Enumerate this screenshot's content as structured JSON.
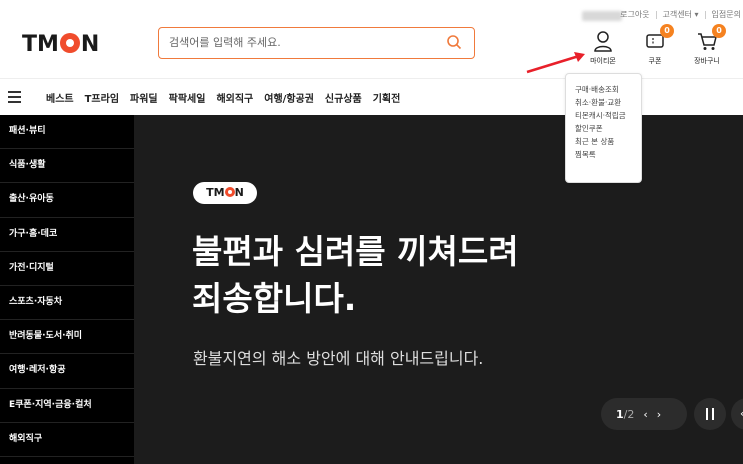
{
  "topbar": {
    "links": [
      "로그아웃",
      "고객센터 ▾",
      "입점문의"
    ]
  },
  "header": {
    "logo": "TMON",
    "search_placeholder": "검색어를 입력해 주세요.",
    "mytmon_label": "마이티몬",
    "coupon_label": "쿠폰",
    "coupon_count": "0",
    "cart_label": "장바구니",
    "cart_count": "0"
  },
  "nav": {
    "items": [
      "베스트",
      "T프라임",
      "파워딜",
      "팍팍세일",
      "해외직구",
      "여행/항공권",
      "신규상품",
      "기획전"
    ]
  },
  "dropdown": {
    "items": [
      "구매·배송조회",
      "취소·환불·교환",
      "티몬캐시·적립금",
      "할인쿠폰",
      "최근 본 상품",
      "찜목록"
    ]
  },
  "sidebar": {
    "items": [
      "패션·뷰티",
      "식품·생활",
      "출산·유아동",
      "가구·홈·데코",
      "가전·디지털",
      "스포츠·자동차",
      "반려동물·도서·취미",
      "여행·레저·항공",
      "E쿠폰·지역·금융·컬처",
      "해외직구"
    ]
  },
  "banner": {
    "badge": "TMON",
    "title": "불편과 심려를 끼쳐드려\n죄송합니다.",
    "subtitle": "환불지연의 해소 방안에 대해 안내드립니다.",
    "page_current": "1",
    "page_total": "/2"
  },
  "colors": {
    "accent": "#f04c2c",
    "badge": "#f58220",
    "search_border": "#f07a3c",
    "arrow": "#e8202a"
  }
}
